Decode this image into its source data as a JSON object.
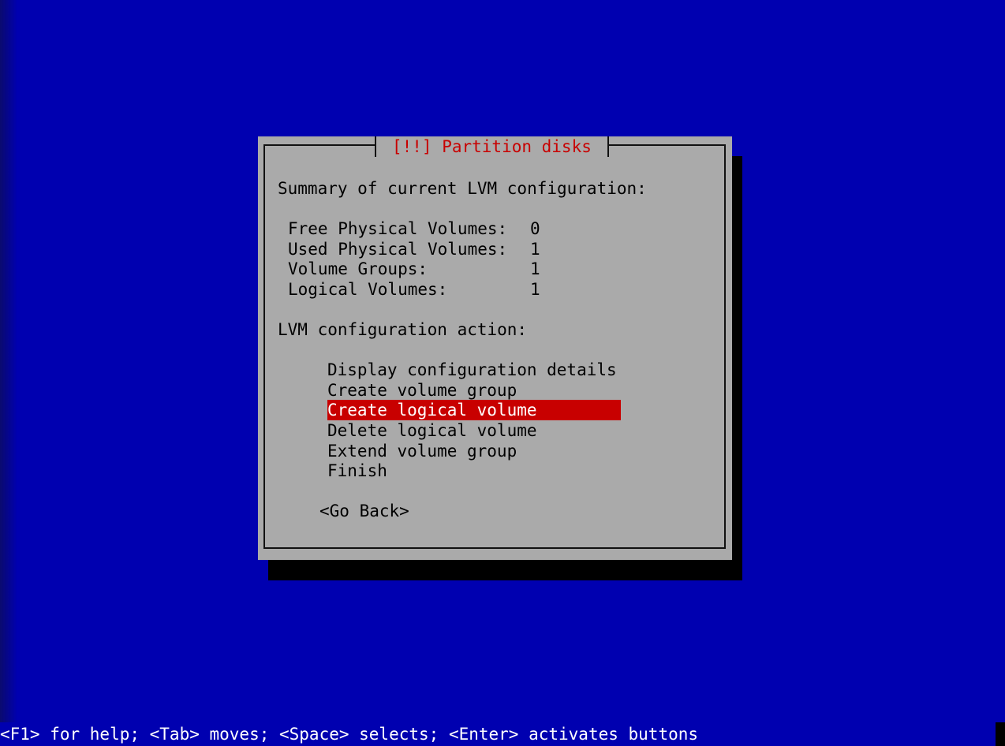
{
  "dialog": {
    "title": "[!!] Partition disks",
    "summary_heading": "Summary of current LVM configuration:",
    "stats": [
      {
        "label": "Free Physical Volumes:",
        "value": "0"
      },
      {
        "label": "Used Physical Volumes:",
        "value": "1"
      },
      {
        "label": "Volume Groups:",
        "value": "1"
      },
      {
        "label": "Logical Volumes:",
        "value": "1"
      }
    ],
    "action_heading": "LVM configuration action:",
    "menu": [
      {
        "label": "Display configuration details",
        "selected": false
      },
      {
        "label": "Create volume group",
        "selected": false
      },
      {
        "label": "Create logical volume",
        "selected": true
      },
      {
        "label": "Delete logical volume",
        "selected": false
      },
      {
        "label": "Extend volume group",
        "selected": false
      },
      {
        "label": "Finish",
        "selected": false
      }
    ],
    "go_back": "<Go Back>"
  },
  "help_bar": "<F1> for help; <Tab> moves; <Space> selects; <Enter> activates buttons",
  "colors": {
    "background": "#0000b0",
    "dialog": "#aaaaaa",
    "shadow": "#000000",
    "title_text": "#c80000",
    "selection": "#c80000",
    "selection_text": "#ffffff",
    "help_text": "#ffffff"
  }
}
